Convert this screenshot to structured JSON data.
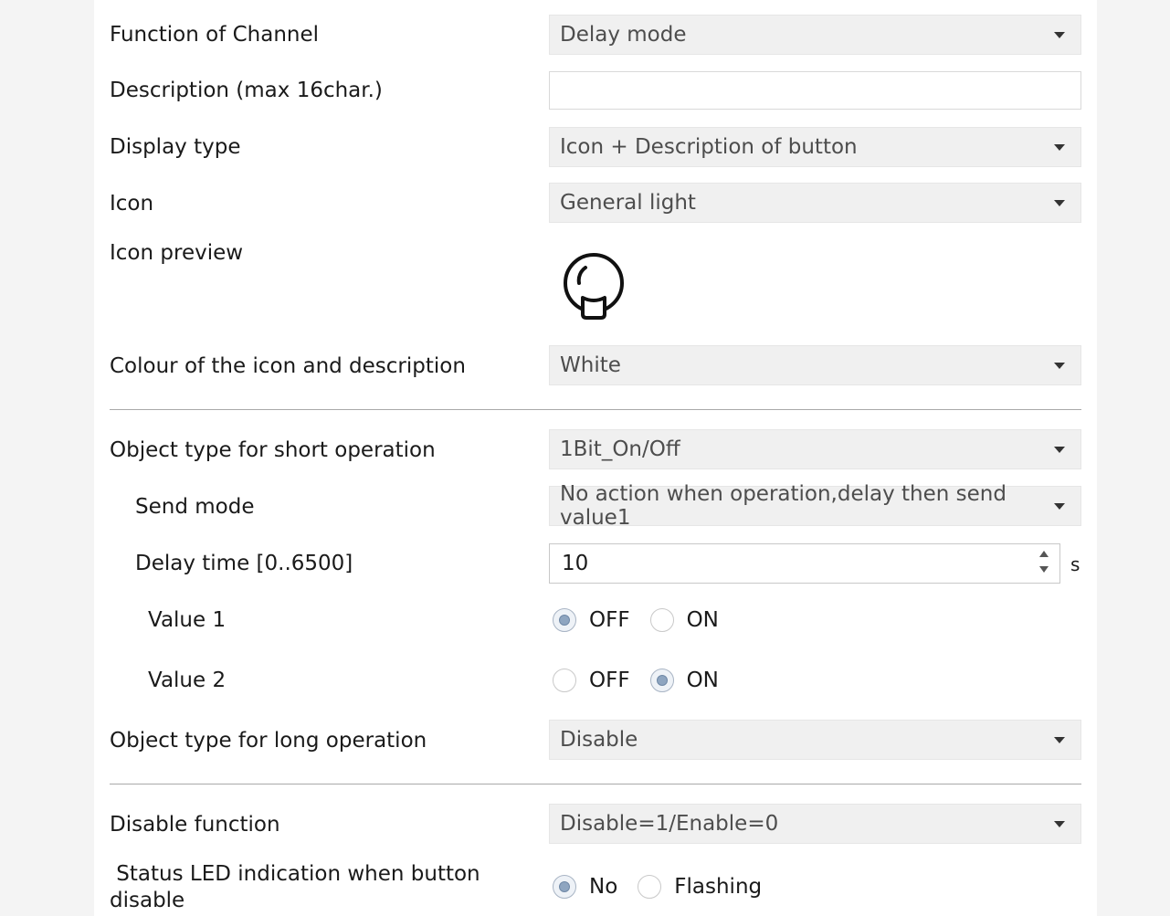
{
  "rows": {
    "function_of_channel": {
      "label": "Function of Channel",
      "value": "Delay mode"
    },
    "description": {
      "label": "Description (max 16char.)",
      "value": ""
    },
    "display_type": {
      "label": "Display type",
      "value": "Icon + Description of button"
    },
    "icon": {
      "label": "Icon",
      "value": "General light"
    },
    "icon_preview": {
      "label": "Icon preview",
      "icon": "light-bulb-icon"
    },
    "colour": {
      "label": "Colour of the icon and description",
      "value": "White"
    },
    "short_object": {
      "label": "Object type for short operation",
      "value": "1Bit_On/Off"
    },
    "send_mode": {
      "label": "Send mode",
      "value": "No action when operation,delay then send value1"
    },
    "delay_time": {
      "label": "Delay time [0..6500]",
      "value": "10",
      "unit": "s"
    },
    "value1": {
      "label": "Value 1",
      "options": [
        "OFF",
        "ON"
      ],
      "selected": "OFF"
    },
    "value2": {
      "label": "Value 2",
      "options": [
        "OFF",
        "ON"
      ],
      "selected": "ON"
    },
    "long_object": {
      "label": "Object type for long operation",
      "value": "Disable"
    },
    "disable_function": {
      "label": "Disable function",
      "value": "Disable=1/Enable=0"
    },
    "status_led": {
      "label_line1": " Status LED indication when button",
      "label_line2": "disable",
      "options": [
        "No",
        "Flashing"
      ],
      "selected": "No"
    }
  },
  "colors": {
    "sidebar": "#f4f4f4",
    "dropdown_bg": "#f0f0f0",
    "radio_selected": "#8ea5c0",
    "separator": "#a9a9a9"
  }
}
